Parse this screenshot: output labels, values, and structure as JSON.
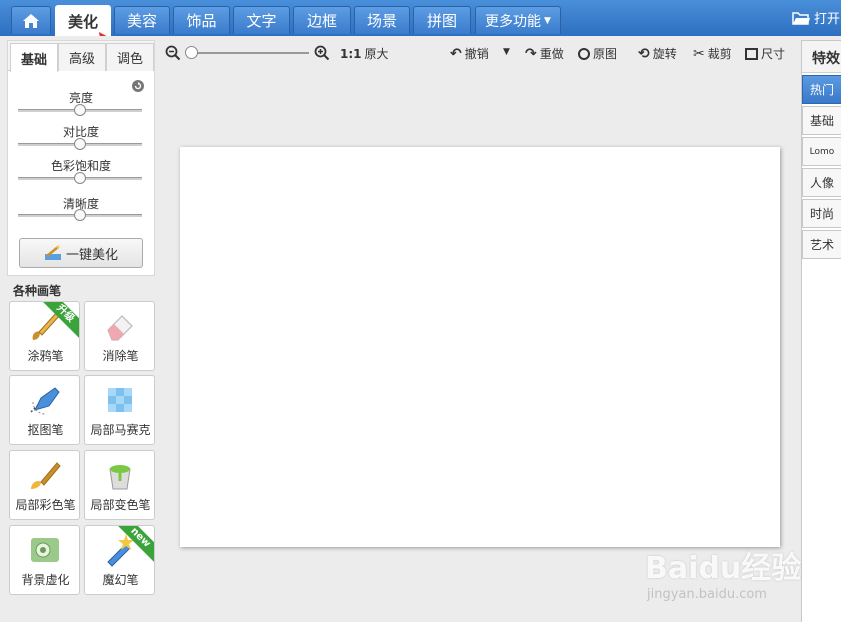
{
  "nav": {
    "home_icon": "home-icon",
    "tabs": [
      {
        "label": "美化",
        "active": true
      },
      {
        "label": "美容"
      },
      {
        "label": "饰品"
      },
      {
        "label": "文字"
      },
      {
        "label": "边框"
      },
      {
        "label": "场景"
      },
      {
        "label": "拼图"
      }
    ],
    "more_label": "更多功能",
    "open_label": "打开"
  },
  "adjust_panel": {
    "tabs": [
      "基础",
      "高级",
      "调色"
    ],
    "active_tab": "基础",
    "sliders": [
      {
        "label": "亮度",
        "value": 0.5
      },
      {
        "label": "对比度",
        "value": 0.5
      },
      {
        "label": "色彩饱和度",
        "value": 0.5
      },
      {
        "label": "清晰度",
        "value": 0.5
      }
    ],
    "one_key_label": "一键美化"
  },
  "brushes": {
    "title": "各种画笔",
    "items": [
      {
        "label": "涂鸦笔",
        "badge": "升级",
        "icon": "paintbrush-icon"
      },
      {
        "label": "消除笔",
        "icon": "eraser-icon"
      },
      {
        "label": "抠图笔",
        "icon": "cutout-pen-icon"
      },
      {
        "label": "局部马赛克",
        "icon": "mosaic-icon"
      },
      {
        "label": "局部彩色笔",
        "icon": "color-brush-icon"
      },
      {
        "label": "局部变色笔",
        "icon": "paint-bucket-icon"
      },
      {
        "label": "背景虚化",
        "icon": "blur-background-icon"
      },
      {
        "label": "魔幻笔",
        "badge": "new",
        "icon": "magic-pen-icon"
      }
    ]
  },
  "toolbar": {
    "zoom_actual": "1:1",
    "zoom_original_size": "原大",
    "undo": "撤销",
    "redo": "重做",
    "original": "原图",
    "rotate": "旋转",
    "crop": "裁剪",
    "resize": "尺寸"
  },
  "effects_panel": {
    "title": "特效",
    "items": [
      "热门",
      "基础",
      "Lomo",
      "人像",
      "时尚",
      "艺术"
    ],
    "active": "热门"
  },
  "watermark": {
    "logo_text": "Baidu经验",
    "url": "jingyan.baidu.com"
  },
  "colors": {
    "nav_blue": "#3a7bcc",
    "annotation_red": "#e03030",
    "upgrade_green": "#3aa33a"
  }
}
